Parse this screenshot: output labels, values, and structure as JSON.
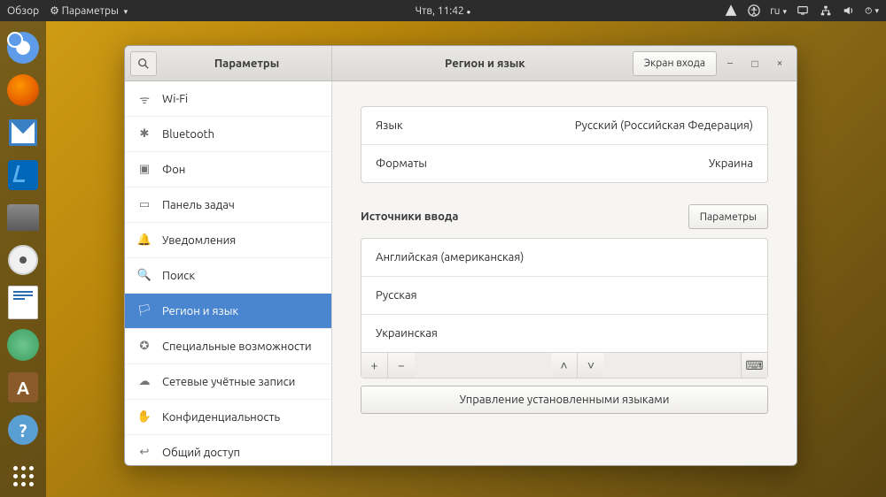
{
  "topbar": {
    "overview": "Обзор",
    "app_menu": "Параметры",
    "clock": "Чтв, 11:42",
    "input_lang": "ru"
  },
  "window": {
    "header_left_title": "Параметры",
    "header_right_title": "Регион и язык",
    "login_screen_btn": "Экран входа"
  },
  "sidebar": {
    "items": [
      {
        "icon": "wifi",
        "label": "Wi-Fi"
      },
      {
        "icon": "bluetooth",
        "label": "Bluetooth"
      },
      {
        "icon": "background",
        "label": "Фон"
      },
      {
        "icon": "dock",
        "label": "Панель задач"
      },
      {
        "icon": "notifications",
        "label": "Уведомления"
      },
      {
        "icon": "search",
        "label": "Поиск"
      },
      {
        "icon": "region",
        "label": "Регион и язык"
      },
      {
        "icon": "a11y",
        "label": "Специальные возможности"
      },
      {
        "icon": "online",
        "label": "Сетевые учётные записи"
      },
      {
        "icon": "privacy",
        "label": "Конфиденциальность"
      },
      {
        "icon": "share",
        "label": "Общий доступ"
      }
    ],
    "active_index": 6
  },
  "content": {
    "language_label": "Язык",
    "language_value": "Русский (Российская Федерация)",
    "formats_label": "Форматы",
    "formats_value": "Украина",
    "input_sources_title": "Источники ввода",
    "input_sources_settings_btn": "Параметры",
    "input_sources": [
      "Английская (американская)",
      "Русская",
      "Украинская"
    ],
    "manage_languages_btn": "Управление установленными языками"
  }
}
